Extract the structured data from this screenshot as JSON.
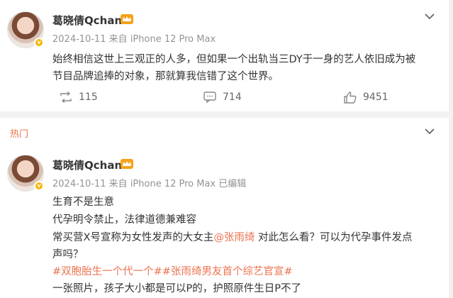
{
  "post1": {
    "username": "葛晓倩Qchan",
    "meta": "2024-10-11  来自 iPhone 12 Pro Max",
    "text_lines": [
      "始终相信这世上三观正的人多，但如果一个出轨当三DY于一身的艺人依旧成为被",
      "节目品牌追捧的对象，那就算我信错了这个世界。"
    ],
    "actions": {
      "repost": "115",
      "comment": "714",
      "like": "9451"
    }
  },
  "section_label": "热门",
  "post2": {
    "username": "葛晓倩Qchan",
    "meta": "2024-10-11  来自 iPhone 12 Pro Max 已编辑",
    "line1": "生育不是生意",
    "line2": "代孕明令禁止，法律道德兼难容",
    "line3_pre": "常买营X号宣称为女性发声的大女主",
    "line3_mention": "@张雨绮",
    "line3_post": " 对此怎么看？可以为代孕事件发点",
    "line4": "声吗？",
    "hashtags": "#双胞胎生一个代一个##张雨绮男友首个综艺官宣#",
    "line6": "一张照片，孩子大小都是可以P的，护照原件生日P不了"
  },
  "colors": {
    "accent": "#eb7350",
    "meta": "#939393",
    "badge": "#f7b500"
  },
  "icons": [
    "verified-badge-icon",
    "crown-icon",
    "chevron-down-icon",
    "repost-icon",
    "comment-icon",
    "like-icon"
  ]
}
